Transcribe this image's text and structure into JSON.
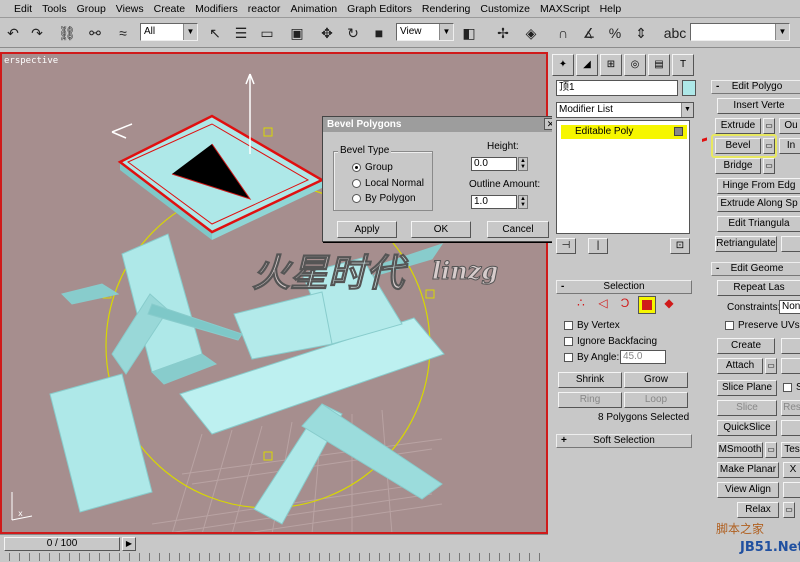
{
  "menu": [
    "Edit",
    "Tools",
    "Group",
    "Views",
    "Create",
    "Modifiers",
    "reactor",
    "Animation",
    "Graph Editors",
    "Rendering",
    "Customize",
    "MAXScript",
    "Help"
  ],
  "toolbar": {
    "selection_filter": "All",
    "reference_coord": "View"
  },
  "viewport": {
    "label": "erspective"
  },
  "dialog": {
    "title": "Bevel Polygons",
    "bevel_type_label": "Bevel Type",
    "options": [
      "Group",
      "Local Normal",
      "By Polygon"
    ],
    "selected_option": "Group",
    "height_label": "Height:",
    "height_value": "0.0",
    "outline_label": "Outline Amount:",
    "outline_value": "1.0",
    "apply": "Apply",
    "ok": "OK",
    "cancel": "Cancel"
  },
  "watermark": {
    "cn": "火星时代",
    "en": "linzg"
  },
  "command_panel": {
    "object_name": "顶1",
    "modifier_list": "Modifier List",
    "stack_item": "Editable Poly",
    "selection_title": "Selection",
    "by_vertex": "By Vertex",
    "ignore_backfacing": "Ignore Backfacing",
    "by_angle": "By Angle:",
    "angle_value": "45.0",
    "shrink": "Shrink",
    "grow": "Grow",
    "ring": "Ring",
    "loop": "Loop",
    "status": "8 Polygons Selected",
    "soft_selection": "Soft Selection"
  },
  "right_panel": {
    "edit_polygons": "Edit Polygo",
    "insert_vertex": "Insert Verte",
    "extrude": "Extrude",
    "outline": "Ou",
    "bevel": "Bevel",
    "inset": "In",
    "bridge": "Bridge",
    "hinge": "Hinge From Edg",
    "extrude_spline": "Extrude Along Sp",
    "edit_tri": "Edit Triangula",
    "retriangulate": "Retriangulate",
    "edit_geometry": "Edit Geome",
    "repeat_last": "Repeat Las",
    "constraints": "Constraints:",
    "constraints_value": "Non",
    "preserve_uvs": "Preserve UVs",
    "create": "Create",
    "attach": "Attach",
    "slice_plane": "Slice Plane",
    "slice": "Slice",
    "reset": "Res",
    "quickslice": "QuickSlice",
    "msmooth": "MSmooth",
    "tessellate": "Tes",
    "make_planar": "Make Planar",
    "view_align": "View Align",
    "relax": "Relax"
  },
  "timeline": {
    "frame": "0 / 100"
  },
  "site_watermark": {
    "cn": "脚本之家",
    "url": "JB51.Net"
  },
  "colors": {
    "viewport_bg": "#a68e8e",
    "viewport_border": "#d01a1a",
    "highlight_yellow": "#f6f600",
    "arrow_red": "#e01010",
    "mesh_fill": "#aee8e8"
  }
}
